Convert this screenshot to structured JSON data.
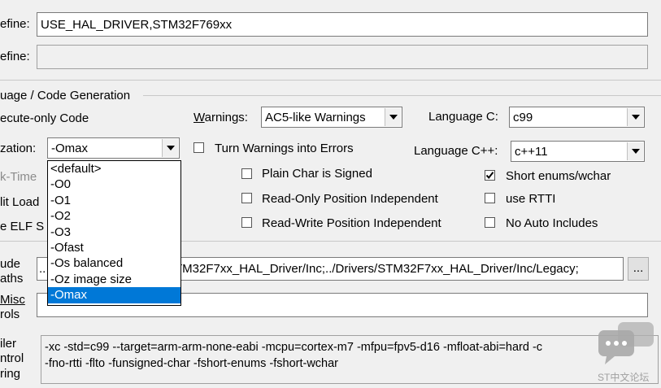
{
  "define": {
    "label": "efine:",
    "value": "USE_HAL_DRIVER,STM32F769xx"
  },
  "undefine": {
    "label": "efine:",
    "value": ""
  },
  "group": {
    "title": "uage / Code Generation"
  },
  "execute_only": {
    "label": "ecute-only Code"
  },
  "warnings": {
    "label_pre": "W",
    "label_ul": "a",
    "label_post": "rnings:",
    "value": "AC5-like Warnings"
  },
  "language_c": {
    "label": "Language C:",
    "value": "c99"
  },
  "optimization": {
    "label": "zation:",
    "value": "-Omax"
  },
  "turn_warnings": {
    "label": "Turn Warnings into Errors",
    "checked": false
  },
  "language_cpp": {
    "label": "Language C++:",
    "value": "c++11"
  },
  "left_cut": {
    "link_time": "k-Time",
    "split_load": "lit Load",
    "elf": "e ELF S"
  },
  "plain_char": {
    "label": "Plain Char is Signed",
    "checked": false
  },
  "short_enums": {
    "label": "Short enums/wchar",
    "checked": true
  },
  "ro_pi": {
    "label": "Read-Only Position Independent",
    "checked": false
  },
  "use_rtti": {
    "label": "use RTTI",
    "checked": false
  },
  "rw_pi": {
    "label": "Read-Write Position Independent",
    "checked": false
  },
  "no_auto": {
    "label": "No Auto Includes",
    "checked": false
  },
  "dropdown": {
    "options": [
      "<default>",
      "-O0",
      "-O1",
      "-O2",
      "-O3",
      "-Ofast",
      "-Os balanced",
      "-Oz image size",
      "-Omax"
    ],
    "selected": "-Omax"
  },
  "include": {
    "label1": "ude",
    "label2": "aths",
    "value_prefix": "..",
    "value": "TM32F7xx_HAL_Driver/Inc;../Drivers/STM32F7xx_HAL_Driver/Inc/Legacy;",
    "browse": "..."
  },
  "misc": {
    "label1": "Misc",
    "label2": "rols",
    "value": ""
  },
  "compiler": {
    "label1": "iler",
    "label2": "ntrol",
    "label3": "ring",
    "line1": "-xc -std=c99 --target=arm-arm-none-eabi -mcpu=cortex-m7 -mfpu=fpv5-d16 -mfloat-abi=hard -c",
    "line2": "-fno-rtti -flto -funsigned-char -fshort-enums -fshort-wchar"
  },
  "watermark": {
    "text": "ST中文论坛"
  }
}
